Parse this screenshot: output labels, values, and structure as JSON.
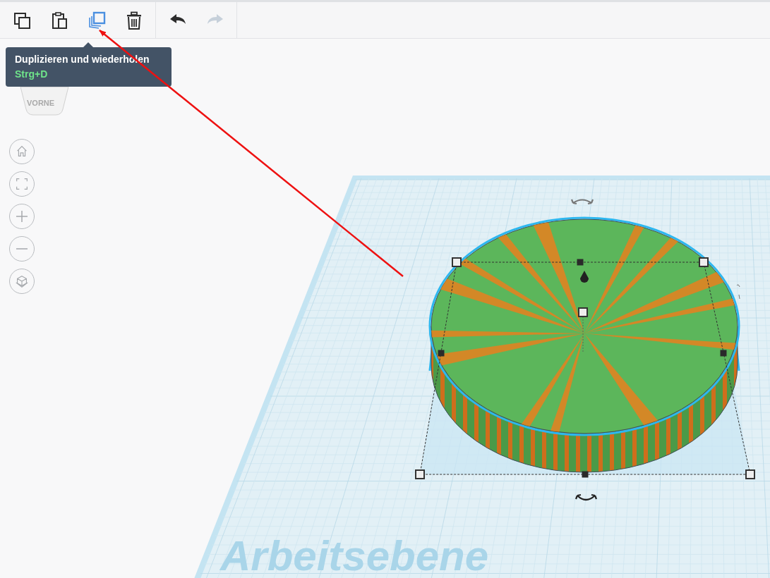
{
  "toolbar": {
    "buttons": [
      {
        "kind": "copy",
        "selected": false,
        "disabled": false
      },
      {
        "kind": "paste",
        "selected": false,
        "disabled": false
      },
      {
        "kind": "duplicate",
        "selected": true,
        "disabled": false
      },
      {
        "kind": "delete",
        "selected": false,
        "disabled": false
      },
      {
        "kind": "undo",
        "selected": false,
        "disabled": false
      },
      {
        "kind": "redo",
        "selected": false,
        "disabled": true
      }
    ]
  },
  "tooltip": {
    "title": "Duplizieren und wiederholen",
    "shortcut": "Strg+D"
  },
  "view_cube": {
    "face": "VORNE"
  },
  "nav_buttons": [
    {
      "kind": "home"
    },
    {
      "kind": "fit"
    },
    {
      "kind": "zoom-in"
    },
    {
      "kind": "zoom-out"
    },
    {
      "kind": "view"
    }
  ],
  "workplane": {
    "label": "Arbeitsebene"
  }
}
